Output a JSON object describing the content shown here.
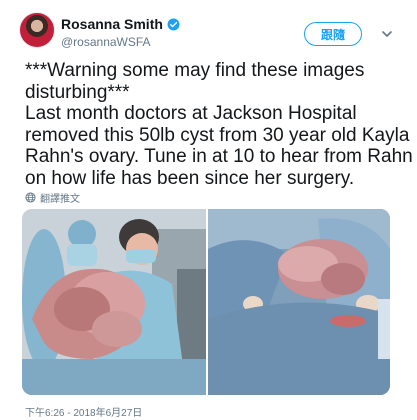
{
  "header": {
    "display_name": "Rosanna Smith",
    "handle": "@rosannaWSFA",
    "follow_label": "跟隨",
    "colors": {
      "accent": "#1da1f2"
    }
  },
  "tweet": {
    "lines": [
      "***Warning some may find these images",
      "disturbing***",
      "Last month doctors at Jackson Hospital",
      "removed this 50lb cyst from 30 year old Kayla",
      "Rahn's ovary. Tune in at 10 to hear from Rahn",
      "on how life has been since her surgery."
    ],
    "translate_label": "翻譯推文"
  },
  "media": {
    "images": [
      {
        "name": "surgery-photo-left"
      },
      {
        "name": "surgery-photo-right"
      }
    ]
  },
  "footer": {
    "timestamp": "下午6:26 - 2018年6月27日"
  }
}
